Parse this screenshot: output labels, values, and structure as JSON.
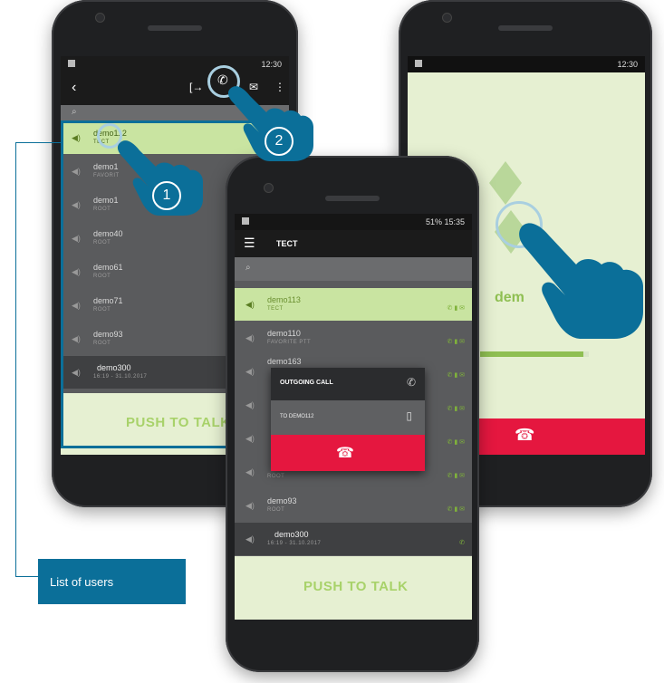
{
  "callout": {
    "label": "List of users"
  },
  "steps": {
    "one": "1",
    "two": "2"
  },
  "left_phone": {
    "status_time": "12:30",
    "rows": [
      {
        "name": "demo112",
        "sub": "TECT"
      },
      {
        "name": "demo1",
        "sub": "FAVORIT"
      },
      {
        "name": "demo1",
        "sub": "ROOT"
      },
      {
        "name": "demo40",
        "sub": "ROOT"
      },
      {
        "name": "demo61",
        "sub": "ROOT"
      },
      {
        "name": "demo71",
        "sub": "ROOT"
      },
      {
        "name": "demo93",
        "sub": "ROOT"
      },
      {
        "name": "demo300",
        "sub": "16:19 - 31.10.2017"
      }
    ],
    "ptt": "PUSH TO TALK"
  },
  "right_phone": {
    "status_time": "12:30",
    "name_fragment": "dem"
  },
  "center_phone": {
    "status": "51%  15:35",
    "title": "TECT",
    "rows": [
      {
        "name": "demo113",
        "sub": "TECT"
      },
      {
        "name": "demo110",
        "sub": "FAVORITE PTT"
      },
      {
        "name": "demo163",
        "sub": ""
      },
      {
        "name": "",
        "sub": ""
      },
      {
        "name": "",
        "sub": ""
      },
      {
        "name": "",
        "sub": "ROOT"
      },
      {
        "name": "demo93",
        "sub": "ROOT"
      },
      {
        "name": "demo300",
        "sub": "16:19 - 31.10.2017"
      }
    ],
    "dialog": {
      "title": "OUTGOING CALL",
      "target": "TO DEMO112"
    },
    "ptt": "PUSH TO TALK"
  },
  "colors": {
    "accent_blue": "#0b6f99",
    "highlight_green": "#c9e4a1",
    "hangup_red": "#e5173f"
  }
}
